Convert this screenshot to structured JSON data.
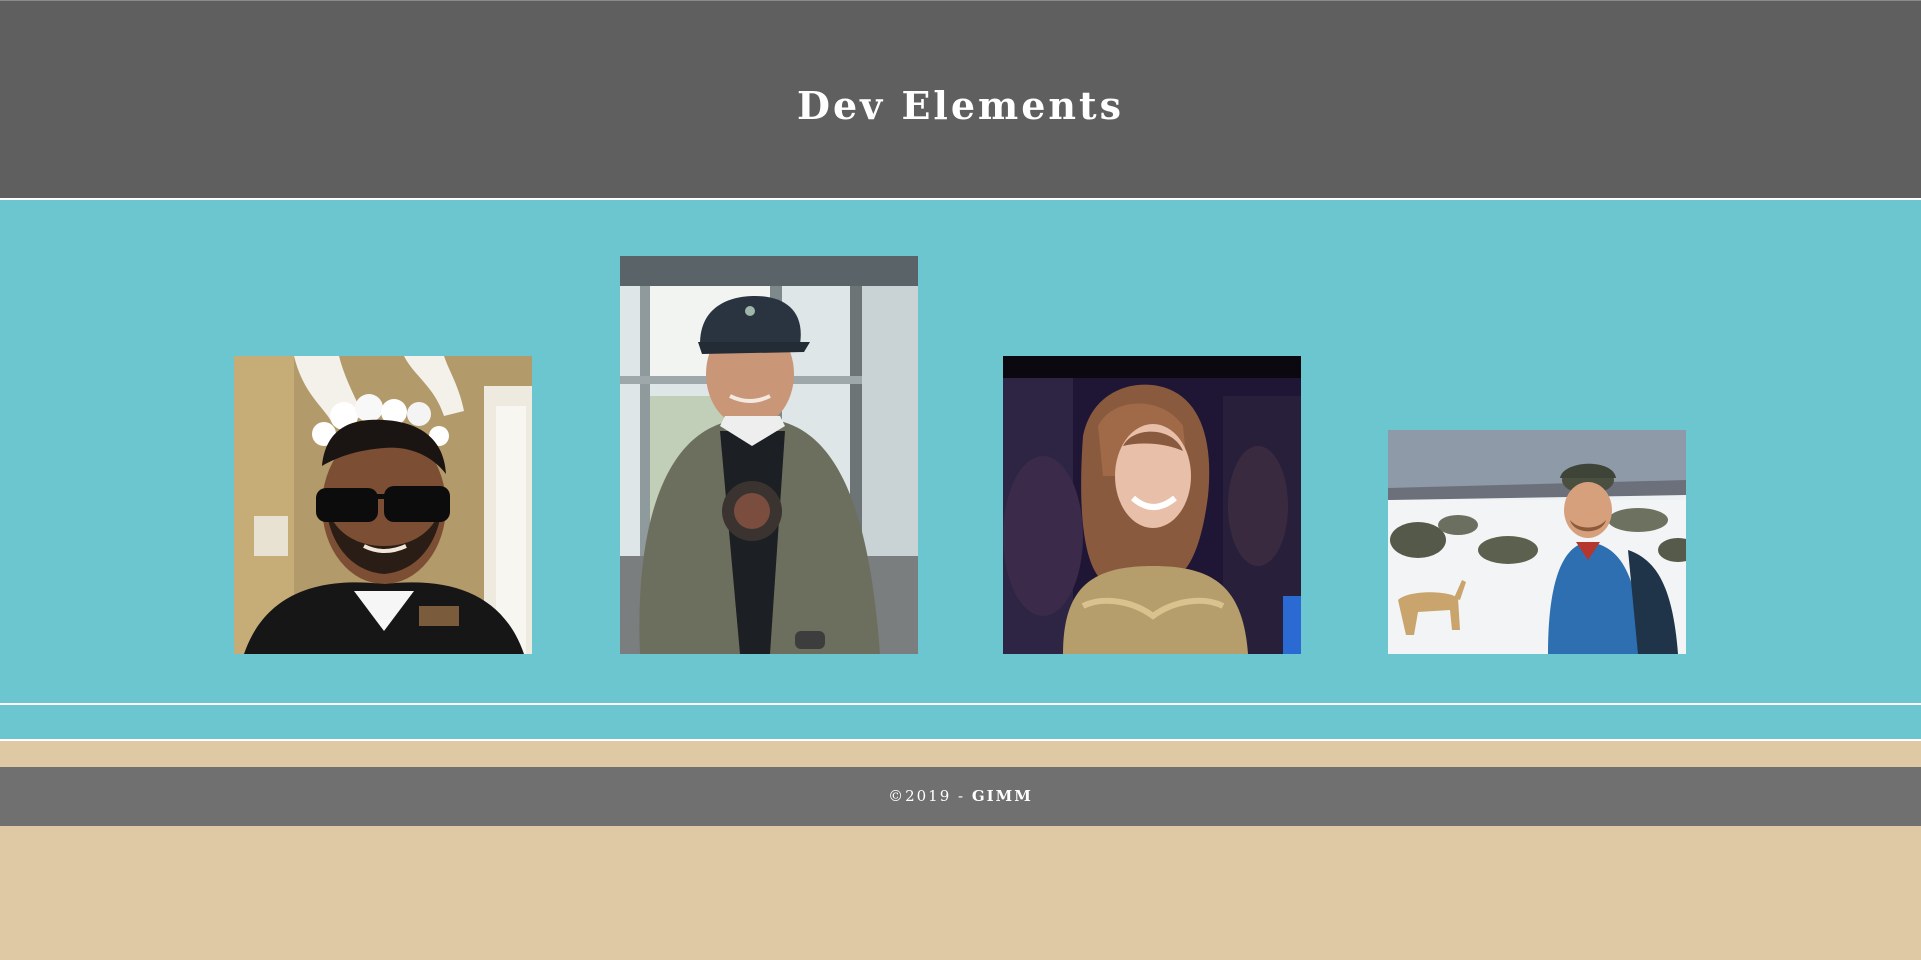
{
  "header": {
    "title": "Dev Elements"
  },
  "gallery": {
    "photos": [
      {
        "subject": "man with sunglasses and antler headband"
      },
      {
        "subject": "man with cap and jacket"
      },
      {
        "subject": "woman laughing in gold dress"
      },
      {
        "subject": "man in blue jacket in snow with dog"
      }
    ]
  },
  "footer": {
    "copyright": "©2019 - ",
    "org": "GIMM"
  },
  "colors": {
    "header_bg": "#5f5f5f",
    "gallery_bg": "#6bc6cf",
    "footer_bg": "#707070",
    "page_bg": "#dfc9a4"
  }
}
